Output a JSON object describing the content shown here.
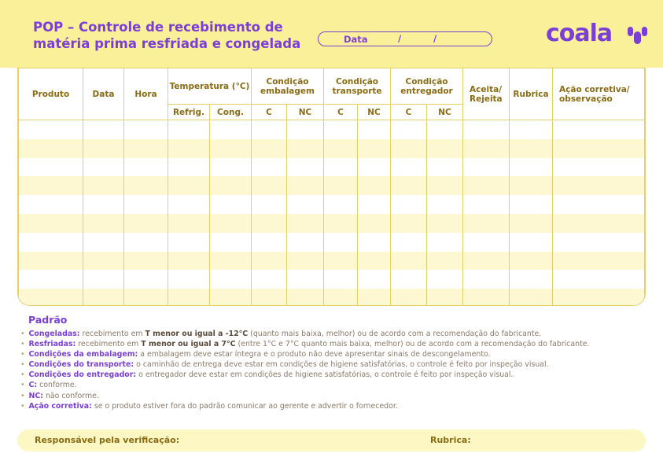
{
  "header": {
    "title_bold": "POP",
    "title_line1_rest": " – Controle de recebimento de",
    "title_line2": "matéria prima resfriada e congelada",
    "date_label": "Data",
    "date_sep1": "/",
    "date_sep2": "/",
    "logo_text": "coala",
    "brand_color": "#7b3fd6",
    "header_bg": "#fbf09a"
  },
  "table": {
    "columns": {
      "produto": "Produto",
      "data": "Data",
      "hora": "Hora",
      "temperatura": "Temperatura (°C)",
      "refrig": "Refrig.",
      "cong": "Cong.",
      "cond_embalagem": "Condição embalagem",
      "cond_transporte": "Condição transporte",
      "cond_entregador": "Condição entregador",
      "c": "C",
      "nc": "NC",
      "aceita": "Aceita/ Rejeita",
      "rubrica": "Rubrica",
      "acao": "Ação corretiva/ observação"
    },
    "empty_rows": 10
  },
  "padrao": {
    "title": "Padrão",
    "rules": [
      {
        "key": "Congeladas:",
        "pre": " recebimento em ",
        "em": "T menor ou igual a -12°C",
        "post": " (quanto mais baixa, melhor) ou de acordo com a recomendação do fabricante."
      },
      {
        "key": "Resfriadas:",
        "pre": " recebimento em ",
        "em": "T menor ou igual a 7°C",
        "post": " (entre 1°C e 7°C quanto mais baixa, melhor) ou de acordo com a recomendação do fabricante."
      },
      {
        "key": "Condições da embalagem:",
        "pre": " a embalagem deve estar íntegra e o produto não deve apresentar sinais de descongelamento.",
        "em": "",
        "post": ""
      },
      {
        "key": "Condições do transporte:",
        "pre": " o caminhão de entrega deve estar em condições de higiene satisfatórias, o controle é feito por inspeção visual.",
        "em": "",
        "post": ""
      },
      {
        "key": "Condições do entregador:",
        "pre": " o entregador deve estar em condições de higiene satisfatórias, o controle é feito por inspeção visual.",
        "em": "",
        "post": ""
      },
      {
        "key": "C:",
        "pre": " conforme.",
        "em": "",
        "post": ""
      },
      {
        "key": "NC:",
        "pre": " não conforme.",
        "em": "",
        "post": ""
      },
      {
        "key": "Ação corretiva:",
        "pre": " se o produto estiver fora do padrão comunicar ao gerente e advertir o fornecedor.",
        "em": "",
        "post": ""
      }
    ]
  },
  "footer": {
    "responsavel": "Responsável pela verificação:",
    "rubrica": "Rubrica:"
  }
}
